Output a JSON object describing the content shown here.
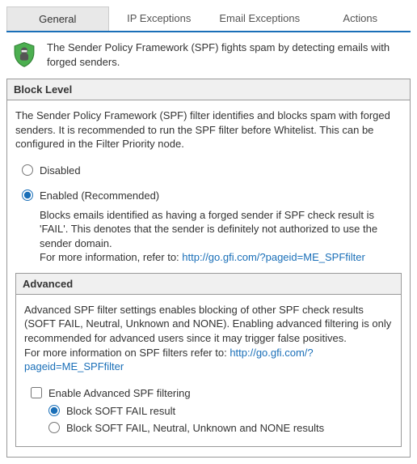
{
  "tabs": {
    "general": "General",
    "ip_exceptions": "IP Exceptions",
    "email_exceptions": "Email Exceptions",
    "actions": "Actions"
  },
  "intro": "The Sender Policy Framework (SPF) fights spam by detecting emails with forged senders.",
  "block_level": {
    "title": "Block Level",
    "description": "The Sender Policy Framework (SPF) filter identifies and blocks spam with forged senders. It is recommended to run the SPF filter before Whitelist. This can be configured in the Filter Priority node.",
    "disabled_label": "Disabled",
    "enabled_label": "Enabled (Recommended)",
    "enabled_note": "Blocks emails identified as having a forged sender if SPF check result is 'FAIL'. This denotes that the sender is definitely not authorized to use the sender domain.",
    "more_info_prefix": "For more information, refer to: ",
    "more_info_link": "http://go.gfi.com/?pageid=ME_SPFfilter"
  },
  "advanced": {
    "title": "Advanced",
    "description": "Advanced SPF filter settings enables blocking of other SPF check results (SOFT FAIL, Neutral, Unknown and NONE). Enabling advanced filtering is only recommended for advanced users since it may trigger false positives.",
    "more_info_prefix": "For more information on SPF filters refer to: ",
    "more_info_link": "http://go.gfi.com/?pageid=ME_SPFfilter",
    "enable_label": "Enable Advanced SPF filtering",
    "opt1": "Block SOFT FAIL result",
    "opt2": "Block SOFT FAIL, Neutral, Unknown and NONE results"
  }
}
